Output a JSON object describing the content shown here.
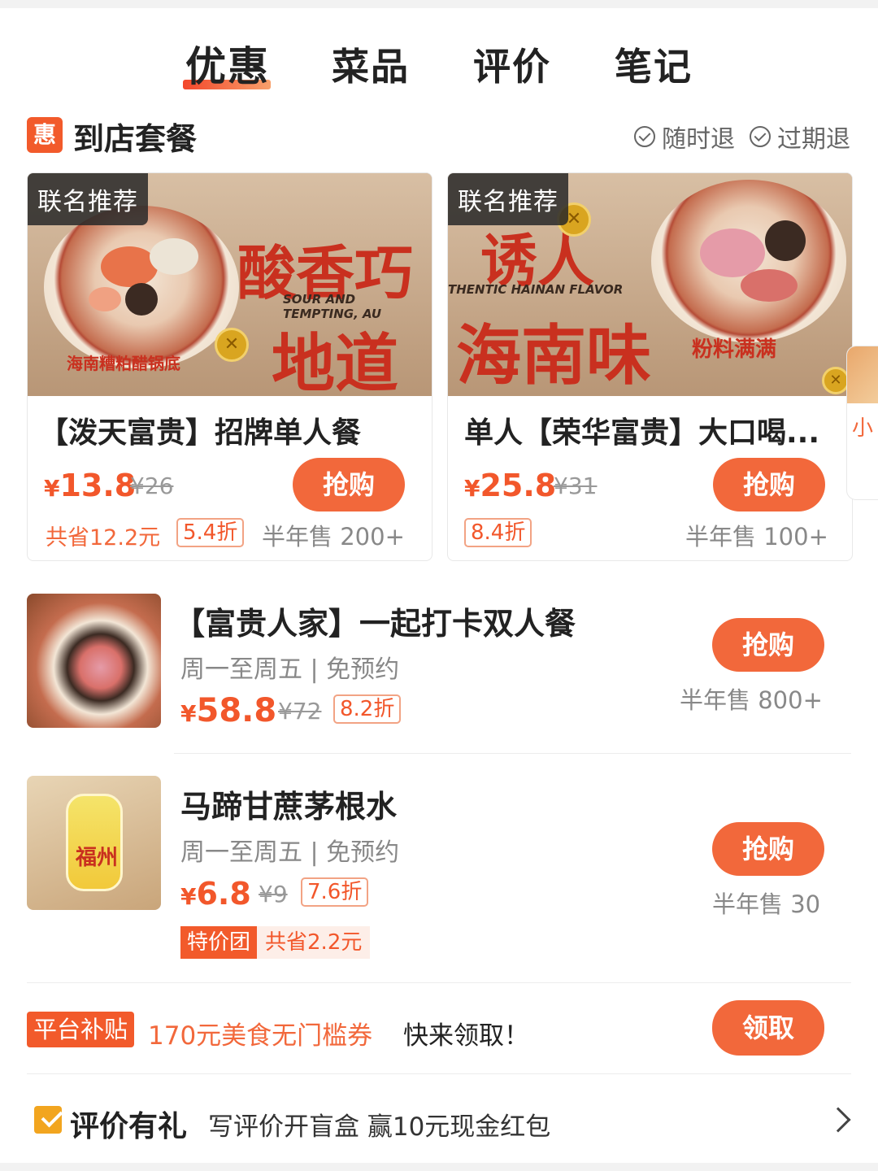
{
  "tabs": [
    {
      "label": "优惠",
      "active": true
    },
    {
      "label": "菜品",
      "active": false
    },
    {
      "label": "评价",
      "active": false
    },
    {
      "label": "笔记",
      "active": false
    }
  ],
  "section": {
    "badge": "惠",
    "title": "到店套餐",
    "guarantees": [
      "随时退",
      "过期退"
    ]
  },
  "cards": [
    {
      "tag": "联名推荐",
      "poster_en": "SOUR AND TEMPTING, AU",
      "poster_big1": "酸香巧",
      "poster_big2": "地道",
      "poster_caption": "海南糟粕醋锅底",
      "name": "【泼天富贵】招牌单人餐",
      "price_symbol": "¥",
      "price": "13.8",
      "original": "¥26",
      "button": "抢购",
      "save": "共省12.2元",
      "discount": "5.4折",
      "sold": "半年售 200+"
    },
    {
      "tag": "联名推荐",
      "poster_en": "THENTIC HAINAN FLAVOR",
      "poster_big1": "诱人",
      "poster_big2": "海南味",
      "poster_caption": "粉料满满",
      "name": "单人【荣华富贵】大口喝...",
      "price_symbol": "¥",
      "price": "25.8",
      "original": "¥31",
      "button": "抢购",
      "discount": "8.4折",
      "sold": "半年售 100+"
    }
  ],
  "peek_text": "小",
  "rows": [
    {
      "title": "【富贵人家】一起打卡双人餐",
      "sub": "周一至周五 | 免预约",
      "price_symbol": "¥",
      "price": "58.8",
      "original": "¥72",
      "discount": "8.2折",
      "button": "抢购",
      "sold": "半年售 800+"
    },
    {
      "title": "马蹄甘蔗茅根水",
      "sub": "周一至周五 | 免预约",
      "price_symbol": "¥",
      "price": "6.8",
      "original": "¥9",
      "discount": "7.6折",
      "special_tag": "特价团",
      "special_save": "共省2.2元",
      "button": "抢购",
      "sold": "半年售 30",
      "thumb_label": "福州"
    }
  ],
  "promo": {
    "tag": "平台补贴",
    "text": "170元美食无门槛券",
    "text2": "快来领取！",
    "button": "领取"
  },
  "review": {
    "title": "评价有礼",
    "text": "写评价开盲盒 赢10元现金红包"
  },
  "colors": {
    "accent": "#f2683b",
    "price": "#f2572b",
    "badge": "#f25a2b"
  }
}
